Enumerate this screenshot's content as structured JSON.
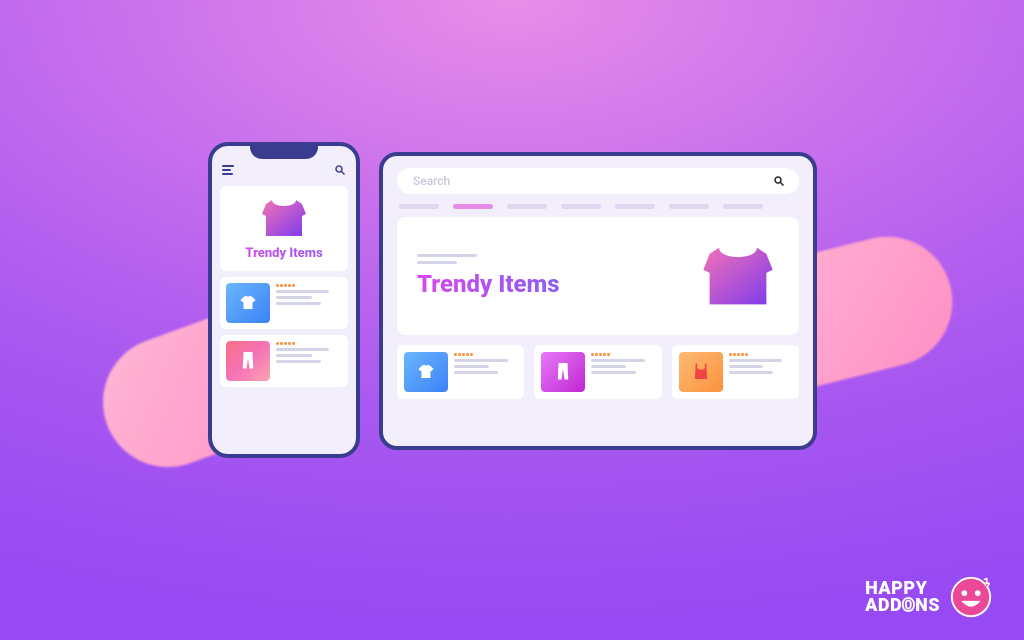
{
  "icons": {
    "hamburger": "hamburger-icon",
    "search": "search-icon",
    "star": "star-icon"
  },
  "phone": {
    "hero_title": "Trendy Items",
    "cards": [
      {
        "variant": "blue",
        "item": "tshirt"
      },
      {
        "variant": "pink",
        "item": "pants"
      }
    ]
  },
  "tablet": {
    "search_placeholder": "Search",
    "hero_title": "Trendy Items",
    "tabs_count": 7,
    "tab_active_index": 1,
    "cards": [
      {
        "variant": "blue",
        "item": "tshirt"
      },
      {
        "variant": "purple",
        "item": "pants"
      },
      {
        "variant": "orange",
        "item": "tank"
      }
    ]
  },
  "logo": {
    "line1": "HAPPY",
    "line2_pre": "ADD",
    "line2_accent": "O",
    "line2_post": "NS"
  },
  "colors": {
    "frame": "#3a3c8f",
    "panel": "#f2eefc",
    "gradient_title_from": "#d946ef",
    "gradient_title_to": "#8b5cf6"
  }
}
